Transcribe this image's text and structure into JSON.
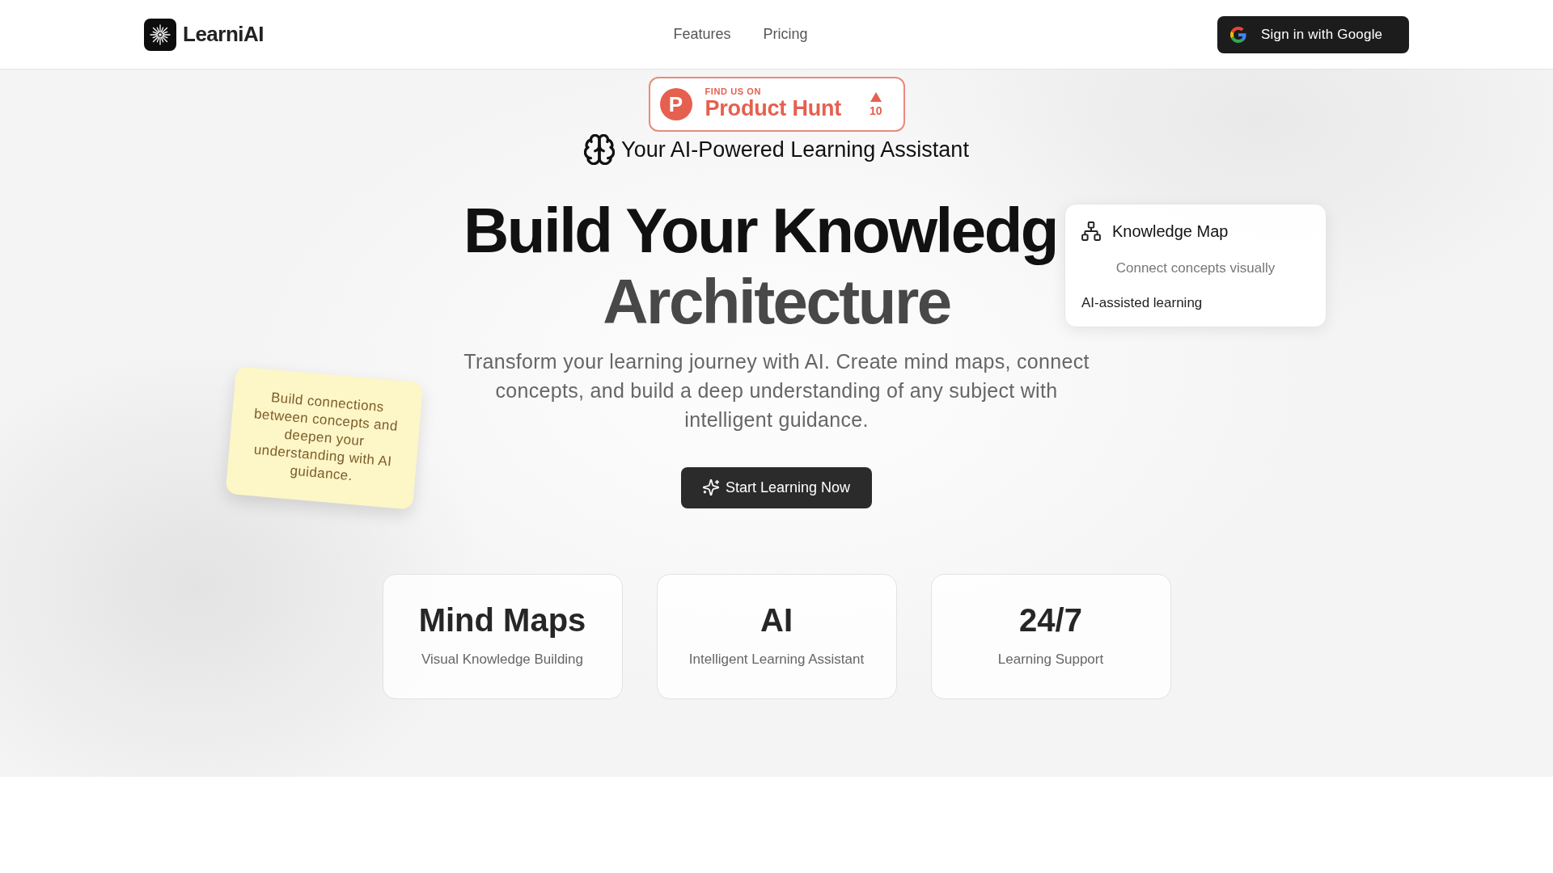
{
  "header": {
    "brand": "LearniAI",
    "nav": [
      {
        "label": "Features"
      },
      {
        "label": "Pricing"
      }
    ],
    "sign_in_button": "Sign in with Google"
  },
  "hero": {
    "badge": {
      "logo_letter": "P",
      "eyebrow": "FIND US ON",
      "name": "Product Hunt",
      "upvotes": "10"
    },
    "tagline": "Your AI-Powered Learning Assistant",
    "heading": [
      "Build Your Knowledg",
      "Architecture"
    ],
    "description": "Transform your learning journey with AI. Create mind maps, connect concepts, and build a deep understanding of any subject with intelligent guidance.",
    "cta_button": "Start Learning Now",
    "note": "Build connections between concepts and deepen your understanding with AI guidance.",
    "knowledge_card": {
      "title": "Knowledge Map",
      "subtitle": "Connect concepts visually",
      "footer": "AI-assisted learning"
    }
  },
  "stats": [
    {
      "value": "Mind Maps",
      "label": "Visual Knowledge Building"
    },
    {
      "value": "AI",
      "label": "Intelligent Learning Assistant"
    },
    {
      "value": "24/7",
      "label": "Learning Support"
    }
  ]
}
